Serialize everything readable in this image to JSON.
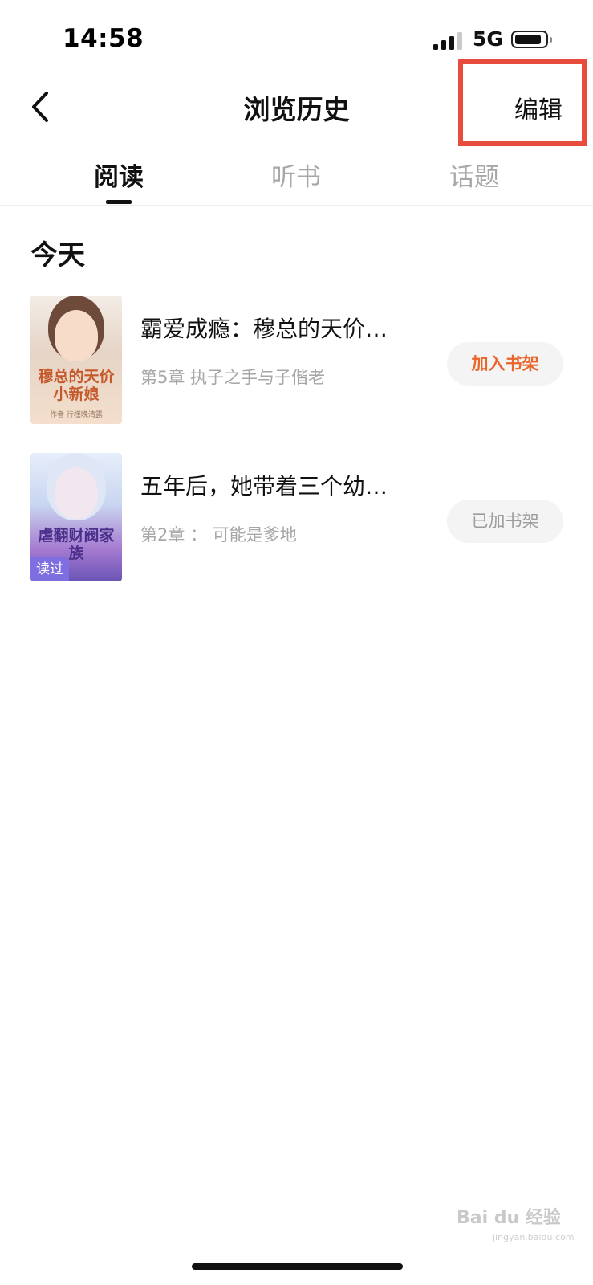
{
  "status": {
    "time": "14:58",
    "network": "5G",
    "battery": 0.8,
    "signal_bars_active": 3
  },
  "header": {
    "back_icon": "chevron-left-icon",
    "title": "浏览历史",
    "edit_label": "编辑",
    "highlight_color": "#e74c3c"
  },
  "tabs": [
    {
      "label": "阅读",
      "active": true
    },
    {
      "label": "听书",
      "active": false
    },
    {
      "label": "话题",
      "active": false
    }
  ],
  "section": {
    "title": "今天"
  },
  "books": [
    {
      "title": "霸爱成瘾：穆总的天价…",
      "chapter": "第5章 执子之手与子偕老",
      "button": "加入书架",
      "cover_title": "穆总的天价小新娘",
      "cover_author": "作者 行槿晚清露"
    },
    {
      "title": "五年后，她带着三个幼…",
      "chapter": "第2章 ： 可能是爹地",
      "button": "已加书架",
      "cover_title": "虐翻财阀家族",
      "cover_tag": "读过"
    }
  ],
  "colors": {
    "accent_orange": "#e8662c",
    "tab_inactive": "#a7a7a7",
    "chapter_gray": "#a6a6a6"
  },
  "watermark": {
    "text": "Bai du 经验",
    "sub": "jingyan.baidu.com"
  }
}
